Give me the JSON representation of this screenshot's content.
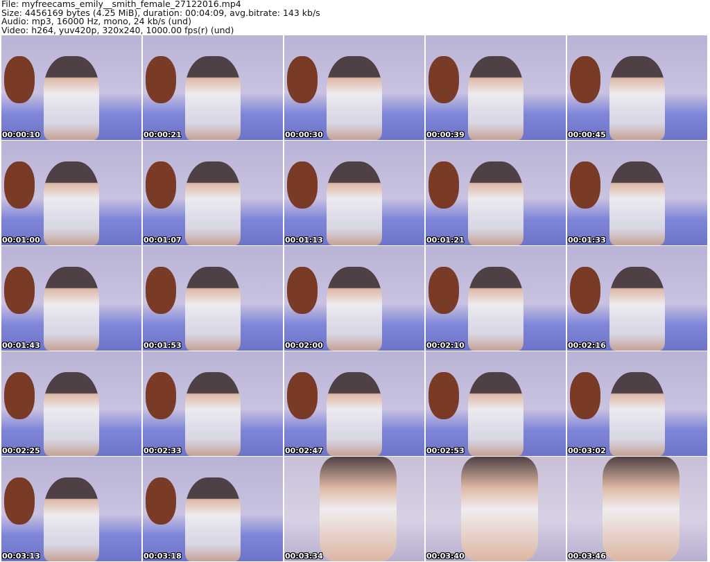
{
  "header": {
    "file": "File: myfreecams_emily__smith_female_27122016.mp4",
    "size": "Size: 4456169 bytes (4.25 MiB), duration: 00:04:09, avg.bitrate: 143 kb/s",
    "audio": "Audio: mp3, 16000 Hz, mono, 24 kb/s (und)",
    "video": "Video: h264, yuv420p, 320x240, 1000.00 fps(r) (und)"
  },
  "thumbnails": [
    "00:00:10",
    "00:00:21",
    "00:00:30",
    "00:00:39",
    "00:00:45",
    "00:01:00",
    "00:01:07",
    "00:01:13",
    "00:01:21",
    "00:01:33",
    "00:01:43",
    "00:01:53",
    "00:02:00",
    "00:02:10",
    "00:02:16",
    "00:02:25",
    "00:02:33",
    "00:02:47",
    "00:02:53",
    "00:03:02",
    "00:03:13",
    "00:03:18",
    "00:03:34",
    "00:03:40",
    "00:03:46"
  ]
}
